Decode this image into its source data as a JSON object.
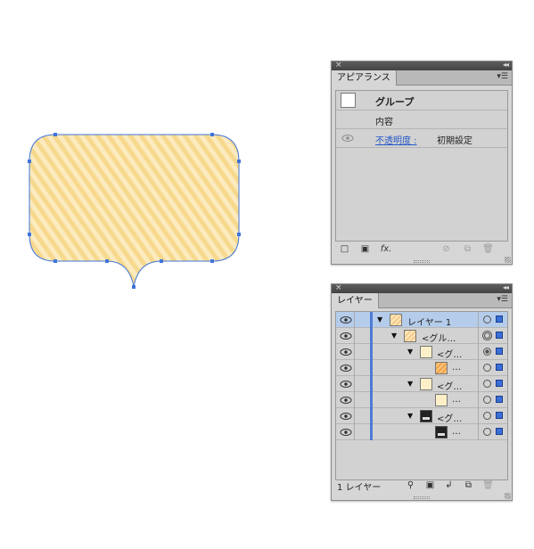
{
  "appearance_panel": {
    "tab_label": "アピアランス",
    "title": "グループ",
    "contents_label": "内容",
    "opacity_label": "不透明度 :",
    "opacity_value": "初期設定",
    "footer_fx": "fx."
  },
  "layers_panel": {
    "tab_label": "レイヤー",
    "footer_count": "1 レイヤー",
    "rows": [
      {
        "name": "レイヤー 1",
        "selected": true,
        "thumb": "stripe",
        "target": "single"
      },
      {
        "name": "<グル…",
        "selected": false,
        "thumb": "stripe",
        "target": "double"
      },
      {
        "name": "<グ…",
        "selected": false,
        "thumb": "light",
        "target": "filled"
      },
      {
        "name": "…",
        "selected": false,
        "thumb": "orange",
        "target": "single"
      },
      {
        "name": "<グ…",
        "selected": false,
        "thumb": "light",
        "target": "single"
      },
      {
        "name": "…",
        "selected": false,
        "thumb": "light",
        "target": "single"
      },
      {
        "name": "<グ…",
        "selected": false,
        "thumb": "dark",
        "target": "single"
      },
      {
        "name": "…",
        "selected": false,
        "thumb": "dark",
        "target": "single"
      }
    ]
  },
  "colors": {
    "shape_fill_a": "#f7d98e",
    "shape_fill_b": "#fcebbf",
    "path_stroke": "#3f74d9",
    "layer_color": "#4f7bd6"
  }
}
